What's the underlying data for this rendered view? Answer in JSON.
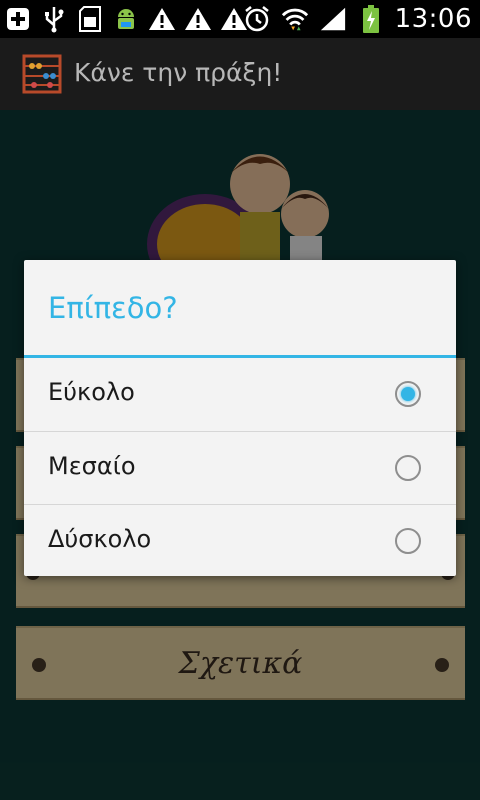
{
  "status_bar": {
    "time": "13:06",
    "icons_left": [
      "add-icon",
      "usb-icon",
      "sd-card-icon",
      "android-icon",
      "warning-icon",
      "warning-icon",
      "warning-icon"
    ],
    "icons_right": [
      "alarm-icon",
      "wifi-icon",
      "signal-icon",
      "battery-charging-icon"
    ]
  },
  "action_bar": {
    "title": "Κάνε την πράξη!",
    "icon": "abacus-icon"
  },
  "background": {
    "menu_items": [
      "Σχετικά"
    ]
  },
  "dialog": {
    "title": "Επίπεδο?",
    "options": [
      {
        "label": "Εύκολο",
        "selected": true
      },
      {
        "label": "Μεσαίο",
        "selected": false
      },
      {
        "label": "Δύσκολο",
        "selected": false
      }
    ],
    "accent_color": "#33b5e5"
  }
}
